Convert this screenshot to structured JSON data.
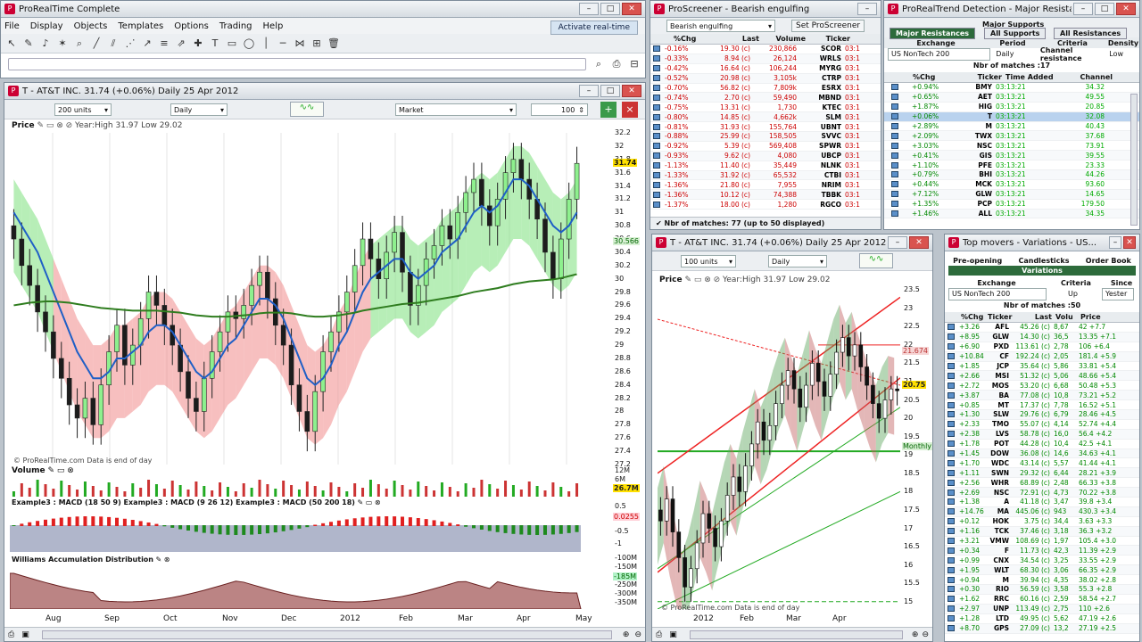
{
  "main_window": {
    "title": "ProRealTime Complete",
    "menu": [
      "File",
      "Display",
      "Objects",
      "Templates",
      "Options",
      "Trading",
      "Help"
    ],
    "activate_label": "Activate real-time"
  },
  "chart1": {
    "title": "T - AT&T INC.   31.74 (+0.06%)   Daily  25 Apr 2012",
    "units": "200 units",
    "period": "Daily",
    "market": "Market",
    "count": "100",
    "price_label": "Price",
    "price_info": "Year:High 31.97 Low 29.02",
    "last_price": "31.74",
    "secondary_price": "30.566",
    "y_ticks": [
      "32.2",
      "32",
      "31.8",
      "31.6",
      "31.4",
      "31.2",
      "31",
      "30.8",
      "30.6",
      "30.4",
      "30.2",
      "30",
      "29.8",
      "29.6",
      "29.4",
      "29.2",
      "29",
      "28.8",
      "28.6",
      "28.4",
      "28.2",
      "28",
      "27.8",
      "27.6",
      "27.4",
      "27.2"
    ],
    "x_ticks": [
      "Aug",
      "Sep",
      "Oct",
      "Nov",
      "Dec",
      "2012",
      "Feb",
      "Mar",
      "Apr",
      "May"
    ],
    "watermark": "© ProRealTime.com  Data is end of day",
    "volume_label": "Volume",
    "volume_ticks": [
      "12M",
      "6M"
    ],
    "volume_last": "26.7M",
    "macd_label": "Example3 : MACD (18 50 9) Example3 : MACD (9 26 12) Example3 : MACD (50 200 18)",
    "macd_ticks": [
      "0.5",
      "0",
      "-0.5",
      "-1"
    ],
    "macd_last": "0.0255",
    "wad_label": "Williams Accumulation Distribution",
    "wad_ticks": [
      "-100M",
      "-150M",
      "-200M",
      "-250M",
      "-300M",
      "-350M"
    ],
    "wad_last": "-185M"
  },
  "screener": {
    "title": "ProScreener - Bearish engulfing",
    "select": "Bearish engulfing",
    "set_button": "Set ProScreener",
    "columns": [
      "%Chg",
      "Last",
      "Volume",
      "Ticker"
    ],
    "rows": [
      [
        "-0.16%",
        "19.30 (c)",
        "230,866",
        "SCOR",
        "03:1"
      ],
      [
        "-0.33%",
        "8.94 (c)",
        "26,124",
        "WRLS",
        "03:1"
      ],
      [
        "-0.42%",
        "16.64 (c)",
        "106,244",
        "MYRG",
        "03:1"
      ],
      [
        "-0.52%",
        "20.98 (c)",
        "3,105k",
        "CTRP",
        "03:1"
      ],
      [
        "-0.70%",
        "56.82 (c)",
        "7,809k",
        "ESRX",
        "03:1"
      ],
      [
        "-0.74%",
        "2.70 (c)",
        "59,490",
        "MBND",
        "03:1"
      ],
      [
        "-0.75%",
        "13.31 (c)",
        "1,730",
        "KTEC",
        "03:1"
      ],
      [
        "-0.80%",
        "14.85 (c)",
        "4,662k",
        "SLM",
        "03:1"
      ],
      [
        "-0.81%",
        "31.93 (c)",
        "155,764",
        "UBNT",
        "03:1"
      ],
      [
        "-0.88%",
        "25.99 (c)",
        "158,505",
        "SVVC",
        "03:1"
      ],
      [
        "-0.92%",
        "5.39 (c)",
        "569,408",
        "SPWR",
        "03:1"
      ],
      [
        "-0.93%",
        "9.62 (c)",
        "4,080",
        "UBCP",
        "03:1"
      ],
      [
        "-1.13%",
        "11.40 (c)",
        "35,449",
        "NLNK",
        "03:1"
      ],
      [
        "-1.33%",
        "31.92 (c)",
        "65,532",
        "CTBI",
        "03:1"
      ],
      [
        "-1.36%",
        "21.80 (c)",
        "7,955",
        "NRIM",
        "03:1"
      ],
      [
        "-1.36%",
        "10.12 (c)",
        "74,388",
        "TBBK",
        "03:1"
      ],
      [
        "-1.37%",
        "18.00 (c)",
        "1,280",
        "RGCO",
        "03:1"
      ]
    ],
    "footer": "Nbr of matches: 77 (up to 50 displayed)"
  },
  "trend": {
    "title": "ProRealTrend Detection - Major Resistance...",
    "tabs": [
      "Major Supports",
      "Major Resistances",
      "All Supports",
      "All Resistances"
    ],
    "crit_headers": [
      "Exchange",
      "Period",
      "Criteria",
      "Density"
    ],
    "crit_values": [
      "US NonTech 200",
      "Daily",
      "Channel resistance",
      "Low"
    ],
    "matches": "Nbr of matches :17",
    "columns": [
      "%Chg",
      "Ticker",
      "Time Added",
      "Channel"
    ],
    "rows": [
      [
        "+0.94%",
        "BMY",
        "03:13:21",
        "34.32"
      ],
      [
        "+0.65%",
        "AET",
        "03:13:21",
        "49.55"
      ],
      [
        "+1.87%",
        "HIG",
        "03:13:21",
        "20.85"
      ],
      [
        "+0.06%",
        "T",
        "03:13:21",
        "32.08"
      ],
      [
        "+2.89%",
        "M",
        "03:13:21",
        "40.43"
      ],
      [
        "+2.09%",
        "TWX",
        "03:13:21",
        "37.68"
      ],
      [
        "+3.03%",
        "NSC",
        "03:13:21",
        "73.91"
      ],
      [
        "+0.41%",
        "GIS",
        "03:13:21",
        "39.55"
      ],
      [
        "+1.10%",
        "PFE",
        "03:13:21",
        "23.33"
      ],
      [
        "+0.79%",
        "BHI",
        "03:13:21",
        "44.26"
      ],
      [
        "+0.44%",
        "MCK",
        "03:13:21",
        "93.60"
      ],
      [
        "+7.12%",
        "GLW",
        "03:13:21",
        "14.65"
      ],
      [
        "+1.35%",
        "PCP",
        "03:13:21",
        "179.50"
      ],
      [
        "+1.46%",
        "ALL",
        "03:13:21",
        "34.35"
      ]
    ]
  },
  "chart2": {
    "title": "T - AT&T INC.   31.74 (+0.06%)   Daily  25 Apr 2012",
    "units": "100 units",
    "period": "Daily",
    "price_label": "Price",
    "price_info": "Year:High 31.97 Low 29.02",
    "y_ticks": [
      "23.5",
      "23",
      "22.5",
      "22",
      "21.5",
      "21",
      "20.5",
      "20",
      "19.5",
      "19",
      "18.5",
      "18",
      "17.5",
      "17",
      "16.5",
      "16",
      "15.5",
      "15"
    ],
    "last_price": "20.75",
    "ref_price": "21.674",
    "monthly_label": "Monthly",
    "x_ticks": [
      "2012",
      "Feb",
      "Mar",
      "Apr"
    ],
    "watermark": "© ProRealTime.com  Data is end of day"
  },
  "movers": {
    "title": "Top movers - Variations - US...",
    "tabs": [
      "Pre-opening",
      "Candlesticks",
      "Order Book",
      "Variations"
    ],
    "crit_headers": [
      "Exchange",
      "Criteria",
      "Since"
    ],
    "crit_values": [
      "US NonTech 200",
      "Up",
      "Yester"
    ],
    "matches": "Nbr of matches :50",
    "columns": [
      "%Chg",
      "Ticker",
      "Last",
      "Volu",
      "Price"
    ],
    "rows": [
      [
        "+3.26",
        "AFL",
        "45.26 (c)",
        "8,67",
        "42 +7.7"
      ],
      [
        "+8.95",
        "GLW",
        "14.30 (c)",
        "36,5",
        "13.35 +7.1"
      ],
      [
        "+6.90",
        "PXD",
        "113.61 (c)",
        "2,78",
        "106 +6.4"
      ],
      [
        "+10.84",
        "CF",
        "192.24 (c)",
        "2,05",
        "181.4 +5.9"
      ],
      [
        "+1.85",
        "JCP",
        "35.64 (c)",
        "5,86",
        "33.81 +5.4"
      ],
      [
        "+2.66",
        "MSI",
        "51.32 (c)",
        "5,06",
        "48.66 +5.4"
      ],
      [
        "+2.72",
        "MOS",
        "53.20 (c)",
        "6,68",
        "50.48 +5.3"
      ],
      [
        "+3.87",
        "BA",
        "77.08 (c)",
        "10,8",
        "73.21 +5.2"
      ],
      [
        "+0.85",
        "MT",
        "17.37 (c)",
        "7,78",
        "16.52 +5.1"
      ],
      [
        "+1.30",
        "SLW",
        "29.76 (c)",
        "6,79",
        "28.46 +4.5"
      ],
      [
        "+2.33",
        "TMO",
        "55.07 (c)",
        "4,14",
        "52.74 +4.4"
      ],
      [
        "+2.38",
        "LVS",
        "58.78 (c)",
        "16,0",
        "56.4 +4.2"
      ],
      [
        "+1.78",
        "POT",
        "44.28 (c)",
        "10,4",
        "42.5 +4.1"
      ],
      [
        "+1.45",
        "DOW",
        "36.08 (c)",
        "14,6",
        "34.63 +4.1"
      ],
      [
        "+1.70",
        "WDC",
        "43.14 (c)",
        "5,57",
        "41.44 +4.1"
      ],
      [
        "+1.11",
        "SWN",
        "29.32 (c)",
        "6,44",
        "28.21 +3.9"
      ],
      [
        "+2.56",
        "WHR",
        "68.89 (c)",
        "2,48",
        "66.33 +3.8"
      ],
      [
        "+2.69",
        "NSC",
        "72.91 (c)",
        "4,73",
        "70.22 +3.8"
      ],
      [
        "+1.38",
        "A",
        "41.18 (c)",
        "3,47",
        "39.8 +3.4"
      ],
      [
        "+14.76",
        "MA",
        "445.06 (c)",
        "943",
        "430.3 +3.4"
      ],
      [
        "+0.12",
        "HOK",
        "3.75 (c)",
        "34,4",
        "3.63 +3.3"
      ],
      [
        "+1.16",
        "TCK",
        "37.46 (c)",
        "3,18",
        "36.3 +3.2"
      ],
      [
        "+3.21",
        "VMW",
        "108.69 (c)",
        "1,97",
        "105.4 +3.0"
      ],
      [
        "+0.34",
        "F",
        "11.73 (c)",
        "42,3",
        "11.39 +2.9"
      ],
      [
        "+0.99",
        "CNX",
        "34.54 (c)",
        "3,25",
        "33.55 +2.9"
      ],
      [
        "+1.95",
        "WLT",
        "68.30 (c)",
        "3,06",
        "66.35 +2.9"
      ],
      [
        "+0.94",
        "M",
        "39.94 (c)",
        "4,35",
        "38.02 +2.8"
      ],
      [
        "+0.30",
        "RIO",
        "56.59 (c)",
        "3,58",
        "55.3 +2.8"
      ],
      [
        "+1.62",
        "RRC",
        "60.16 (c)",
        "2,59",
        "58.54 +2.7"
      ],
      [
        "+2.97",
        "UNP",
        "113.49 (c)",
        "2,75",
        "110 +2.6"
      ],
      [
        "+1.28",
        "LTD",
        "49.95 (c)",
        "5,62",
        "47.19 +2.6"
      ],
      [
        "+8.70",
        "GPS",
        "27.09 (c)",
        "13,2",
        "27.19 +2.5"
      ]
    ]
  },
  "chart1_data": {
    "type": "candlestick",
    "note_ranges": "price range 27.2–32.2",
    "close": [
      30.6,
      30.2,
      29.9,
      29.5,
      29.2,
      28.8,
      28.5,
      28.1,
      27.9,
      28.2,
      27.8,
      28.4,
      28.9,
      29.3,
      28.7,
      29.0,
      29.4,
      29.8,
      29.6,
      29.3,
      29.0,
      28.6,
      28.2,
      28.0,
      28.5,
      28.9,
      29.2,
      29.5,
      29.4,
      29.6,
      29.9,
      30.1,
      29.7,
      29.3,
      29.0,
      28.4,
      28.0,
      27.7,
      28.3,
      28.9,
      29.2,
      29.5,
      29.8,
      30.2,
      30.6,
      30.3,
      30.0,
      30.4,
      30.7,
      30.1,
      29.6,
      29.9,
      30.3,
      30.5,
      30.8,
      30.6,
      31.0,
      31.3,
      31.5,
      31.1,
      30.8,
      31.2,
      31.6,
      31.8,
      31.5,
      31.2,
      30.9,
      30.4,
      30.0,
      30.6,
      31.2,
      31.74
    ],
    "ma_fast": [
      31.0,
      30.8,
      30.6,
      30.4,
      30.1,
      29.8,
      29.5,
      29.2,
      28.9,
      28.7,
      28.5,
      28.5,
      28.6,
      28.8,
      28.8,
      28.9,
      29.0,
      29.2,
      29.3,
      29.3,
      29.2,
      29.0,
      28.8,
      28.6,
      28.5,
      28.6,
      28.8,
      29.0,
      29.1,
      29.3,
      29.5,
      29.7,
      29.7,
      29.6,
      29.4,
      29.1,
      28.8,
      28.5,
      28.4,
      28.5,
      28.7,
      29.0,
      29.2,
      29.5,
      29.8,
      30.0,
      30.1,
      30.2,
      30.3,
      30.3,
      30.1,
      30.0,
      30.1,
      30.2,
      30.4,
      30.5,
      30.6,
      30.8,
      31.0,
      31.1,
      31.0,
      31.1,
      31.3,
      31.5,
      31.5,
      31.4,
      31.2,
      31.0,
      30.8,
      30.7,
      30.8,
      31.0
    ],
    "ma_slow": [
      29.6,
      29.62,
      29.64,
      29.65,
      29.66,
      29.66,
      29.65,
      29.64,
      29.62,
      29.6,
      29.58,
      29.56,
      29.55,
      29.54,
      29.53,
      29.52,
      29.52,
      29.52,
      29.52,
      29.51,
      29.5,
      29.49,
      29.47,
      29.45,
      29.44,
      29.43,
      29.43,
      29.43,
      29.44,
      29.45,
      29.46,
      29.48,
      29.49,
      29.49,
      29.49,
      29.48,
      29.46,
      29.44,
      29.43,
      29.43,
      29.44,
      29.45,
      29.47,
      29.49,
      29.52,
      29.54,
      29.56,
      29.58,
      29.6,
      29.62,
      29.63,
      29.64,
      29.66,
      29.68,
      29.7,
      29.72,
      29.74,
      29.77,
      29.8,
      29.82,
      29.84,
      29.86,
      29.89,
      29.92,
      29.94,
      29.96,
      29.97,
      29.98,
      29.99,
      30.01,
      30.04,
      30.07
    ]
  },
  "chart2_data": {
    "type": "candlestick",
    "close": [
      17.2,
      17.8,
      16.9,
      16.2,
      15.4,
      15.9,
      16.6,
      17.4,
      17.0,
      16.5,
      17.2,
      17.9,
      18.4,
      18.0,
      18.7,
      19.3,
      19.9,
      19.4,
      19.8,
      20.4,
      20.9,
      21.3,
      20.8,
      20.3,
      20.9,
      21.5,
      21.0,
      20.6,
      21.2,
      21.8,
      22.2,
      21.7,
      22.0,
      21.4,
      20.9,
      20.4,
      20.0,
      20.5,
      20.8,
      20.75
    ]
  }
}
